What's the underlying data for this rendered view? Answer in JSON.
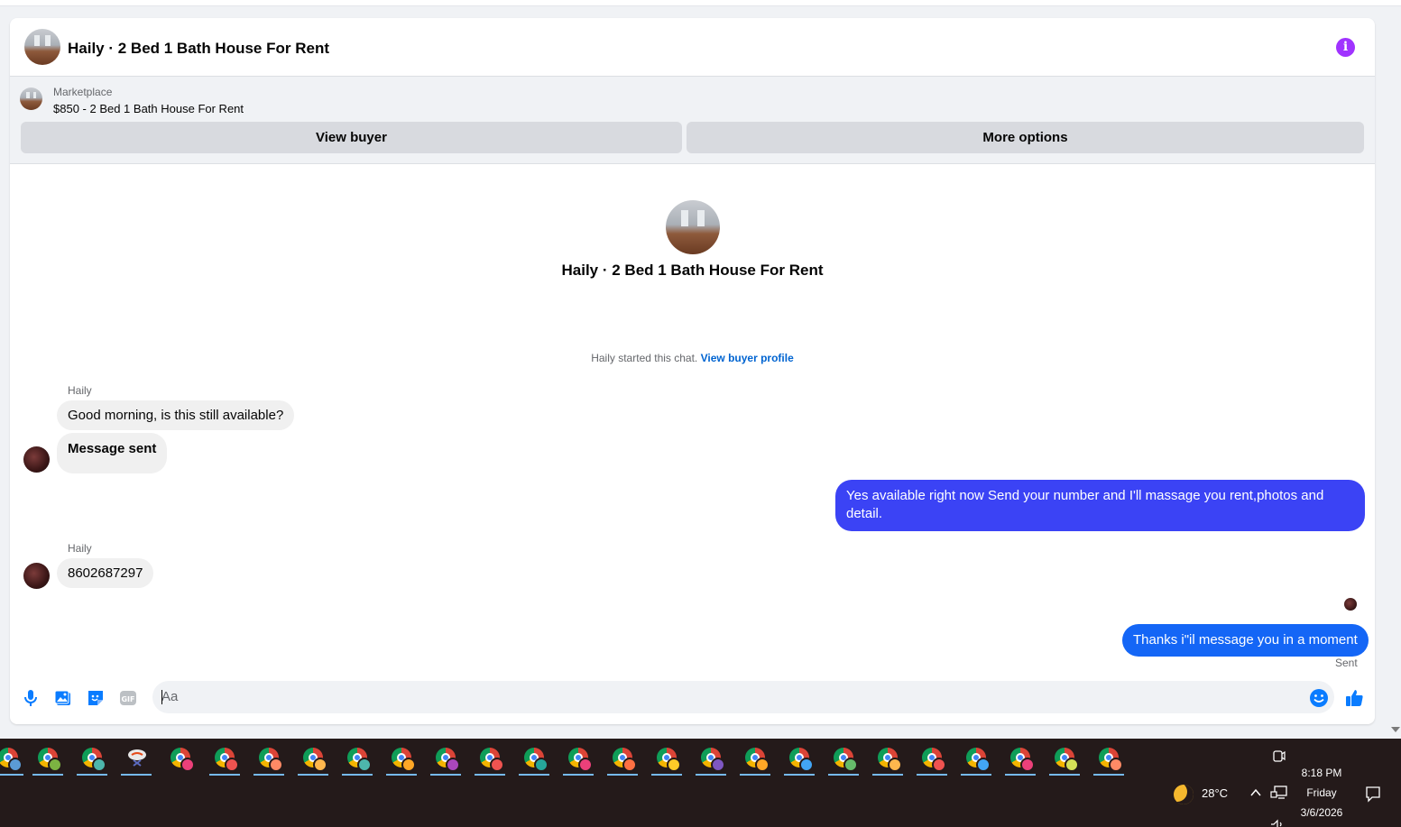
{
  "header": {
    "title": "Haily · 2 Bed 1 Bath House For Rent",
    "info_icon": "i"
  },
  "listing": {
    "category": "Marketplace",
    "price_title": "$850 - 2 Bed 1 Bath House For Rent",
    "view_buyer_label": "View buyer",
    "more_options_label": "More options"
  },
  "conversation": {
    "title": "Haily · 2 Bed 1 Bath House For Rent",
    "started_text": "Haily started this chat.",
    "started_link": "View buyer profile"
  },
  "messages": [
    {
      "from": "Haily",
      "sender_label": "Haily",
      "text": "Good morning, is this still available?"
    },
    {
      "from": "Haily",
      "text": "Message sent"
    },
    {
      "from": "me",
      "text": "Yes available right now Send your number and I'll massage you rent,photos and detail."
    },
    {
      "from": "Haily",
      "sender_label": "Haily",
      "text": "8602687297"
    },
    {
      "from": "me",
      "text": "Thanks i\"il message you in a moment",
      "status": "Sent"
    }
  ],
  "composer": {
    "placeholder": "Aa"
  },
  "taskbar": {
    "weather": {
      "temp": "28°C",
      "icon": "moon-icon"
    },
    "clock": {
      "time": "8:18 PM",
      "day": "Friday",
      "date": "3/6/2026"
    }
  },
  "colors": {
    "accent": "#0a7cff",
    "bubble_out_1": "#3b43f5",
    "bubble_out_2": "#1466f6",
    "info": "#a033ff"
  }
}
